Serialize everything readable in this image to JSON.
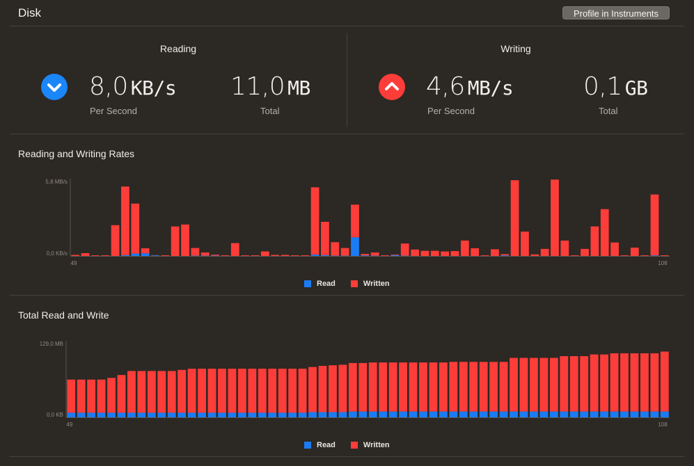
{
  "header": {
    "title": "Disk",
    "profile_button": "Profile in Instruments"
  },
  "reading": {
    "heading": "Reading",
    "per_second_value": "8,0",
    "per_second_unit": "KB/s",
    "per_second_label": "Per Second",
    "total_value": "11,0",
    "total_unit": "MB",
    "total_label": "Total"
  },
  "writing": {
    "heading": "Writing",
    "per_second_value": "4,6",
    "per_second_unit": "MB/s",
    "per_second_label": "Per Second",
    "total_value": "0,1",
    "total_unit": "GB",
    "total_label": "Total"
  },
  "colors": {
    "read": "#1a7cf5",
    "written": "#fc3d39",
    "read_icon": "#1a86f8",
    "write_icon": "#fc3d39"
  },
  "icons": {
    "reading": "chevron-down-icon",
    "writing": "chevron-up-icon"
  },
  "legend": {
    "read": "Read",
    "written": "Written"
  },
  "chart_data": [
    {
      "type": "bar",
      "stacked": true,
      "title": "Reading and Writing Rates",
      "x_start": 49,
      "x_end": 108,
      "ylim": [
        0,
        5.8
      ],
      "ytick_labels": [
        "0,0 KB/s",
        "5,8 MB/s"
      ],
      "xtick_labels": [
        "49",
        "108"
      ],
      "unit": "MB/s",
      "series": [
        {
          "name": "Read",
          "values": [
            0,
            0,
            0,
            0,
            0,
            0.06,
            0.18,
            0.2,
            0.04,
            0,
            0,
            0,
            0.02,
            0.02,
            0.02,
            0,
            0,
            0,
            0,
            0,
            0,
            0,
            0,
            0,
            0.1,
            0.06,
            0.02,
            0.02,
            1.45,
            0.04,
            0.02,
            0,
            0.06,
            0.02,
            0,
            0,
            0,
            0,
            0,
            0,
            0,
            0,
            0,
            0.04,
            0,
            0,
            0,
            0,
            0,
            0,
            0,
            0,
            0,
            0,
            0,
            0,
            0,
            0,
            0.04,
            0
          ]
        },
        {
          "name": "Written",
          "values": [
            0.08,
            0.22,
            0.05,
            0.05,
            2.4,
            5.35,
            3.9,
            0.4,
            0.02,
            0.05,
            2.3,
            2.45,
            0.6,
            0.25,
            0.08,
            0.05,
            1,
            0.05,
            0.05,
            0.35,
            0.08,
            0.08,
            0.05,
            0.05,
            5.25,
            2.6,
            1.05,
            0.6,
            2.55,
            0.12,
            0.25,
            0.05,
            0.05,
            0.95,
            0.5,
            0.4,
            0.4,
            0.35,
            0.38,
            1.2,
            0.6,
            0.05,
            0.52,
            0.1,
            5.9,
            1.9,
            0.12,
            0.55,
            5.95,
            1.2,
            0.05,
            0.55,
            2.3,
            3.65,
            1.05,
            0.05,
            0.65,
            0.05,
            4.75,
            0.05
          ]
        }
      ]
    },
    {
      "type": "bar",
      "stacked": true,
      "title": "Total Read and Write",
      "x_start": 49,
      "x_end": 108,
      "ylim": [
        0,
        129
      ],
      "ytick_labels": [
        "0,0 KB",
        "129,0 MB"
      ],
      "xtick_labels": [
        "49",
        "108"
      ],
      "unit": "MB",
      "series": [
        {
          "name": "Read",
          "values": [
            8,
            8,
            8,
            8,
            8,
            8,
            8,
            8,
            8,
            8,
            8,
            8,
            8,
            8,
            8,
            8,
            8,
            8,
            8,
            8,
            8,
            8,
            8,
            8,
            9,
            9,
            9,
            9,
            10,
            10,
            10,
            10,
            10,
            10,
            10,
            10,
            10,
            10,
            10,
            10,
            10,
            10,
            10,
            10,
            10,
            10,
            10,
            10,
            10,
            10,
            10,
            10,
            10,
            10,
            10,
            10,
            10,
            10,
            10,
            10
          ]
        },
        {
          "name": "Written",
          "values": [
            58,
            58,
            58,
            58,
            61,
            66,
            73,
            73,
            73,
            73,
            73,
            75,
            77,
            77,
            77,
            77,
            77,
            77,
            77,
            77,
            77,
            77,
            77,
            77,
            79,
            81,
            82,
            83,
            85,
            85,
            86,
            86,
            86,
            86,
            86,
            86,
            86,
            86,
            87,
            87,
            87,
            87,
            87,
            87,
            94,
            94,
            94,
            94,
            94,
            97,
            97,
            97,
            100,
            100,
            102,
            102,
            102,
            102,
            102,
            105
          ]
        }
      ]
    }
  ]
}
